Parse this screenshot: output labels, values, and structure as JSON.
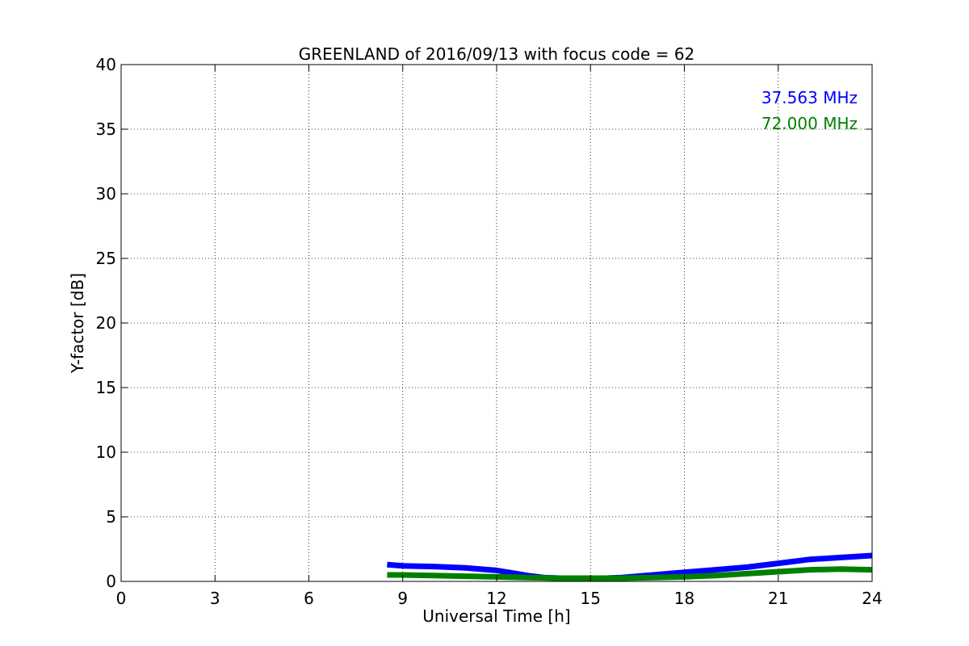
{
  "chart_data": {
    "type": "line",
    "title": "GREENLAND of 2016/09/13 with focus code = 62",
    "xlabel": "Universal Time [h]",
    "ylabel": "Y-factor [dB]",
    "xlim": [
      0,
      24
    ],
    "ylim": [
      0,
      40
    ],
    "xticks": [
      0,
      3,
      6,
      9,
      12,
      15,
      18,
      21,
      24
    ],
    "yticks": [
      0,
      5,
      10,
      15,
      20,
      25,
      30,
      35,
      40
    ],
    "grid": true,
    "legend_placement": "top-right",
    "series": [
      {
        "name": "37.563 MHz",
        "color": "#0000ff",
        "x": [
          8.5,
          9,
          10,
          11,
          12,
          12.5,
          13,
          13.5,
          14,
          15,
          16,
          17,
          18,
          19,
          20,
          21,
          22,
          23,
          24
        ],
        "y": [
          1.3,
          1.2,
          1.15,
          1.05,
          0.85,
          0.65,
          0.45,
          0.3,
          0.25,
          0.2,
          0.3,
          0.5,
          0.7,
          0.9,
          1.1,
          1.4,
          1.7,
          1.85,
          2.0
        ]
      },
      {
        "name": "72.000 MHz",
        "color": "#008000",
        "x": [
          8.5,
          9,
          10,
          11,
          12,
          13,
          14,
          15,
          16,
          17,
          18,
          19,
          20,
          21,
          22,
          23,
          24
        ],
        "y": [
          0.5,
          0.5,
          0.45,
          0.4,
          0.35,
          0.3,
          0.25,
          0.25,
          0.25,
          0.3,
          0.35,
          0.45,
          0.6,
          0.75,
          0.9,
          0.95,
          0.9
        ]
      }
    ]
  }
}
